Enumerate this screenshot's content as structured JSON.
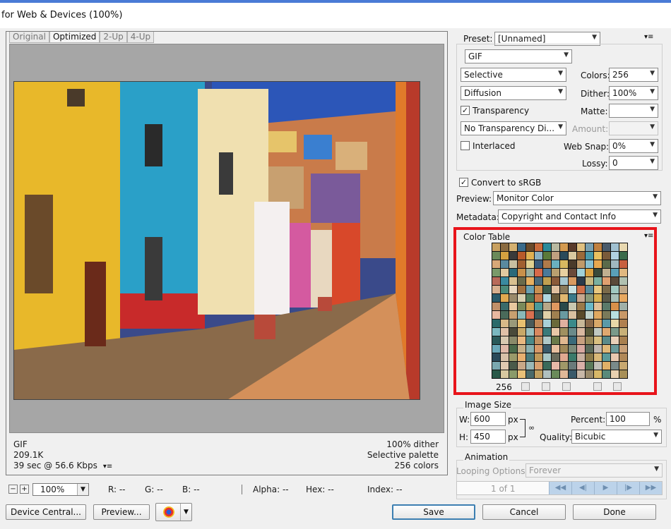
{
  "window": {
    "title": "for Web & Devices (100%)"
  },
  "tabs": [
    "Original",
    "Optimized",
    "2-Up",
    "4-Up"
  ],
  "preview": {
    "format": "GIF",
    "size": "209.1K",
    "speed": "39 sec @ 56.6 Kbps",
    "dither": "100% dither",
    "palette": "Selective palette",
    "colors": "256 colors"
  },
  "status": {
    "zoom": "100%",
    "r": "R: --",
    "g": "G: --",
    "b": "B: --",
    "alpha": "Alpha: --",
    "hex": "Hex: --",
    "index": "Index: --"
  },
  "buttons": {
    "device_central": "Device Central...",
    "preview": "Preview...",
    "save": "Save",
    "cancel": "Cancel",
    "done": "Done"
  },
  "settings": {
    "preset_label": "Preset:",
    "preset_value": "[Unnamed]",
    "format": "GIF",
    "reduction": "Selective",
    "colors_label": "Colors:",
    "colors_value": "256",
    "dither_algo": "Diffusion",
    "dither_label": "Dither:",
    "dither_value": "100%",
    "transparency": "Transparency",
    "matte_label": "Matte:",
    "trans_dither": "No Transparency Di...",
    "amount_label": "Amount:",
    "interlaced": "Interlaced",
    "websnap_label": "Web Snap:",
    "websnap_value": "0%",
    "lossy_label": "Lossy:",
    "lossy_value": "0",
    "convert_srgb": "Convert to sRGB",
    "preview_label": "Preview:",
    "preview_value": "Monitor Color",
    "metadata_label": "Metadata:",
    "metadata_value": "Copyright and Contact Info"
  },
  "color_table": {
    "title": "Color Table",
    "count": "256",
    "swatches": [
      "#c8a060",
      "#8a6a40",
      "#d4b070",
      "#3a6a8a",
      "#6a4a2a",
      "#c86a3a",
      "#2a8a9a",
      "#b8b8a0",
      "#d49a50",
      "#5a3a2a",
      "#e0c080",
      "#7aa0b0",
      "#c08040",
      "#4a5a6a",
      "#a0c0d0",
      "#e8d8b0",
      "#6a8a5a",
      "#d4a040",
      "#3a3a3a",
      "#b85a2a",
      "#e0b050",
      "#8ab0c0",
      "#5a7a3a",
      "#c0a080",
      "#2a4a5a",
      "#d8c8a0",
      "#9a6a3a",
      "#4a9aaa",
      "#e8c060",
      "#7a5a3a",
      "#b0d0e0",
      "#3a6a4a",
      "#d8a878",
      "#5a8aa0",
      "#c8c0a0",
      "#a06030",
      "#e0d090",
      "#3a5a7a",
      "#b07a4a",
      "#6ab0c0",
      "#d8b860",
      "#4a3a2a",
      "#c09a6a",
      "#8ac0d0",
      "#e8a850",
      "#5a6a4a",
      "#a0b8c0",
      "#c86040",
      "#7a9a6a",
      "#e0c8a0",
      "#2a6a7a",
      "#c8904a",
      "#9ab0a0",
      "#d86a4a",
      "#4a7a9a",
      "#b8a070",
      "#e8d0a0",
      "#6a4a3a",
      "#a0d0d8",
      "#d8a040",
      "#3a4a3a",
      "#c0b090",
      "#5aa0b8",
      "#e0b880",
      "#b86a5a",
      "#3a8aa0",
      "#d8c090",
      "#6a6a4a",
      "#e8b060",
      "#4a6a7a",
      "#c0a050",
      "#8a5a3a",
      "#a8c8d0",
      "#d89a60",
      "#2a3a4a",
      "#c8b880",
      "#7ab0a0",
      "#e0a070",
      "#5a4a3a",
      "#b0c0b0",
      "#d8b090",
      "#4a8a7a",
      "#e8d8c0",
      "#a07040",
      "#6aa0b0",
      "#c89050",
      "#3a5a4a",
      "#e0c0a0",
      "#8a7a5a",
      "#c8e0e0",
      "#d0704a",
      "#5a8a9a",
      "#e8c880",
      "#7a6a4a",
      "#a0c8c0",
      "#c0a888",
      "#2a5a6a",
      "#e0a850",
      "#9a8a6a",
      "#d8d0b0",
      "#4a7a5a",
      "#c87a4a",
      "#b0d8e0",
      "#6a5a3a",
      "#e0b870",
      "#3a7a8a",
      "#c8a890",
      "#8a9a7a",
      "#d8b050",
      "#5a5a4a",
      "#a8c0b8",
      "#e8a860",
      "#c0906a",
      "#3a6a6a",
      "#e8c8a0",
      "#7a8a5a",
      "#d0a050",
      "#4a9a9a",
      "#b8a888",
      "#e09860",
      "#2a4a4a",
      "#c8c8b0",
      "#9a7a4a",
      "#6ab8c8",
      "#e0c098",
      "#5a7a6a",
      "#d8904a",
      "#a0b0a8",
      "#e8b8a0",
      "#4a6a5a",
      "#c8a070",
      "#8ab8b8",
      "#d87050",
      "#3a5a5a",
      "#e0d0a8",
      "#a08050",
      "#6a9aa0",
      "#d8c0a0",
      "#5a4a2a",
      "#c0d0c8",
      "#e0a860",
      "#7a7a5a",
      "#b8e0e0",
      "#c89868",
      "#2a6a6a",
      "#d8b888",
      "#9a9a7a",
      "#e8c070",
      "#4a5a5a",
      "#c08858",
      "#a8d0d8",
      "#6a6a3a",
      "#e0b0a0",
      "#3a8a8a",
      "#c8b898",
      "#8a6a4a",
      "#d8a868",
      "#5a9aa8",
      "#e8d8a8",
      "#b08050",
      "#7ab8c0",
      "#e0c0a8",
      "#4a4a3a",
      "#c8a868",
      "#9ac0c0",
      "#d88860",
      "#3a7a7a",
      "#e8c8a8",
      "#a09060",
      "#6a8a8a",
      "#d8b8a0",
      "#5a5a3a",
      "#c0c8c0",
      "#e0a870",
      "#7a9a8a",
      "#c8b078",
      "#2a5a5a",
      "#d8c8b0",
      "#8a8a6a",
      "#e8b880",
      "#4a8a8a",
      "#c09060",
      "#b0c8c8",
      "#6a7a4a",
      "#e0b890",
      "#3a6a7a",
      "#c8a080",
      "#9a8a5a",
      "#d8c080",
      "#5a8a8a",
      "#e8d0b8",
      "#a88050",
      "#6aa8b8",
      "#e0b8a8",
      "#4a6a4a",
      "#c8b088",
      "#8ab0b0",
      "#d89868",
      "#3a5a6a",
      "#e8c0a0",
      "#a08858",
      "#7a8a7a",
      "#d8a8a0",
      "#5a6a5a",
      "#c0b8b0",
      "#e0b878",
      "#6a9a9a",
      "#c8a078",
      "#2a4a5a",
      "#d8c0a8",
      "#9a9a6a",
      "#e8b070",
      "#4a7a7a",
      "#c09858",
      "#a8c8c8",
      "#6a6a5a",
      "#e0a890",
      "#3a7a6a",
      "#c8b0a0",
      "#8a7a4a",
      "#d8b878",
      "#5a9a9a",
      "#e8c8b0",
      "#b08858",
      "#7aa8b0",
      "#e0c8b0",
      "#4a5a4a",
      "#c8a888",
      "#9ab8b8",
      "#d8a070",
      "#3a6a5a",
      "#e8b8a8",
      "#a09868",
      "#6a7a7a",
      "#d8b0a8",
      "#5a7a5a",
      "#c0c0b8",
      "#e0b068",
      "#7a8a8a",
      "#c8a870",
      "#2a5a4a",
      "#d8c8a0",
      "#8a9a6a",
      "#e8c078",
      "#4a6a6a",
      "#c0a060",
      "#b0c0c0",
      "#6a8a5a",
      "#e0b898",
      "#3a5a6a",
      "#c8b8a8",
      "#9a8a6a",
      "#d8b868",
      "#5a8a7a",
      "#e8d0b0",
      "#a89058"
    ]
  },
  "image_size": {
    "title": "Image Size",
    "w_label": "W:",
    "w_value": "600",
    "h_label": "H:",
    "h_value": "450",
    "unit": "px",
    "percent_label": "Percent:",
    "percent_value": "100",
    "percent_unit": "%",
    "quality_label": "Quality:",
    "quality_value": "Bicubic"
  },
  "animation": {
    "title": "Animation",
    "looping_label": "Looping Options:",
    "looping_value": "Forever",
    "frame": "1 of 1"
  }
}
